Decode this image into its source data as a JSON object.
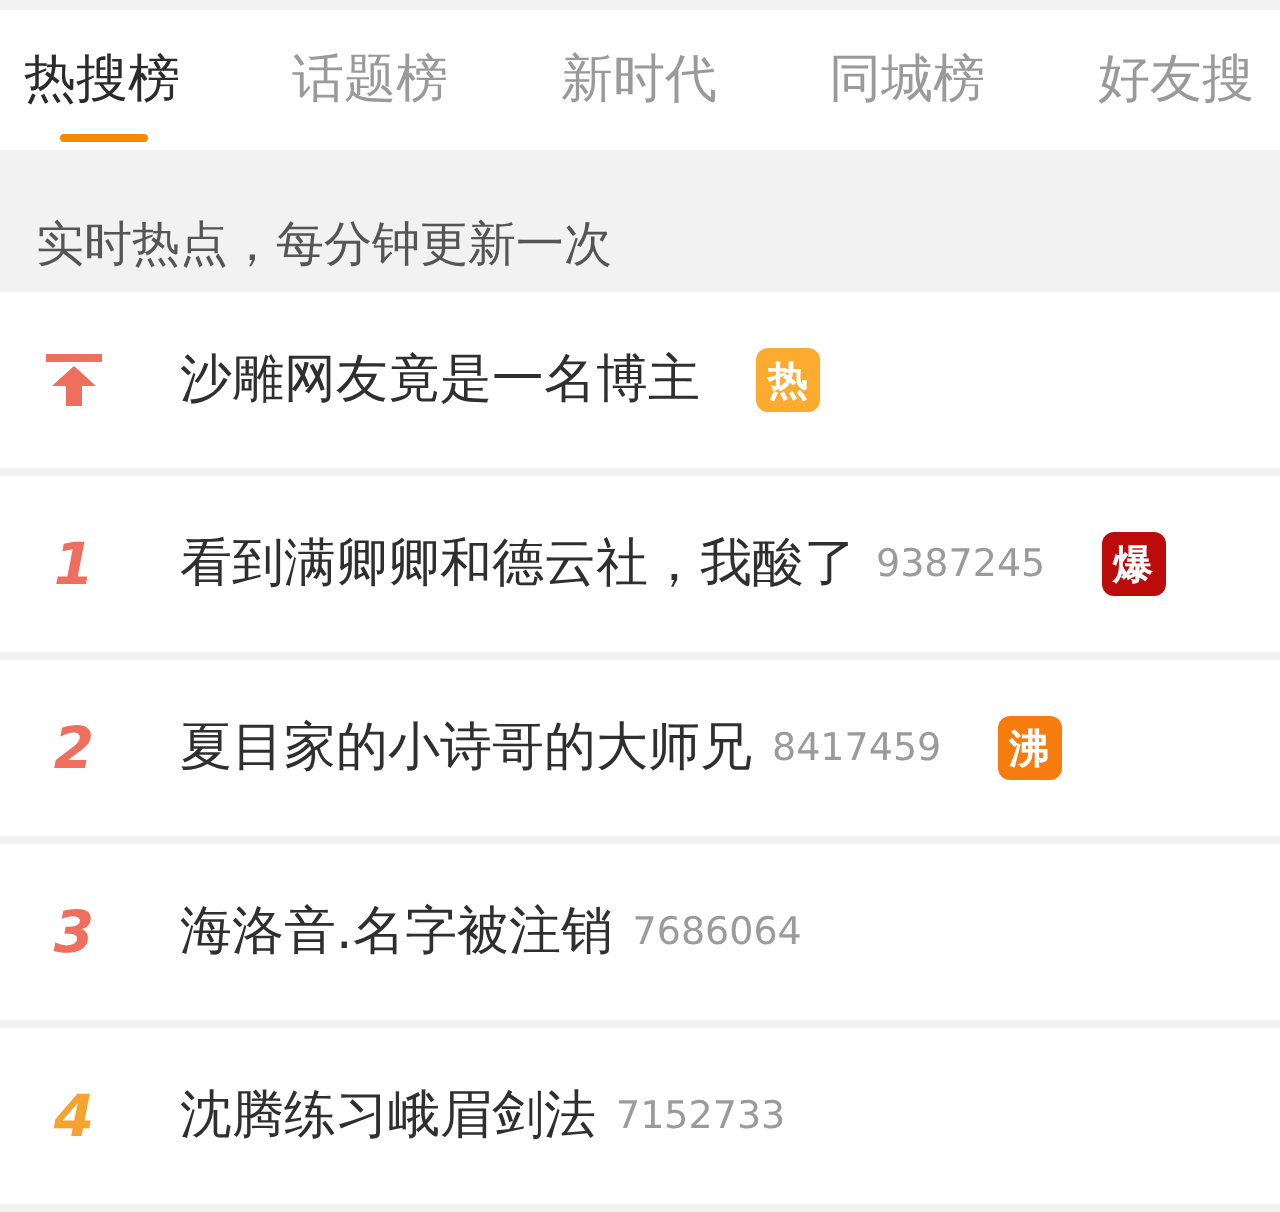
{
  "tabs": [
    {
      "label": "热搜榜",
      "selected": true
    },
    {
      "label": "话题榜",
      "selected": false
    },
    {
      "label": "新时代",
      "selected": false
    },
    {
      "label": "同城榜",
      "selected": false
    },
    {
      "label": "好友搜",
      "selected": false
    }
  ],
  "notice": "实时热点，每分钟更新一次",
  "items": [
    {
      "kind": "pinned",
      "color": "#ef6f5e",
      "title": "沙雕网友竟是一名博主",
      "badge": {
        "text": "热",
        "color": "#fbab2f"
      }
    },
    {
      "kind": "ranked",
      "rank": "1",
      "color": "#ef6f5e",
      "title": "看到满卿卿和德云社，我酸了",
      "count": "9387245",
      "badge": {
        "text": "爆",
        "color": "#bb0b0b"
      }
    },
    {
      "kind": "ranked",
      "rank": "2",
      "color": "#ef6f5e",
      "title": "夏目家的小诗哥的大师兄",
      "count": "8417459",
      "badge": {
        "text": "沸",
        "color": "#f77c10"
      }
    },
    {
      "kind": "ranked",
      "rank": "3",
      "color": "#ef6f5e",
      "title": "海洛音.名字被注销",
      "count": "7686064"
    },
    {
      "kind": "ranked",
      "rank": "4",
      "color": "#f5a22e",
      "title": "沈腾练习峨眉剑法",
      "count": "7152733"
    }
  ]
}
